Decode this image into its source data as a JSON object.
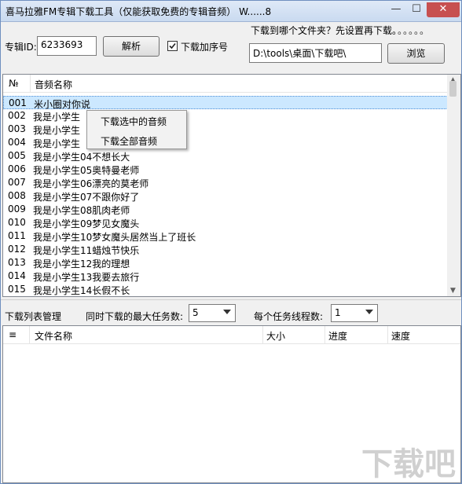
{
  "window": {
    "title": "喜马拉雅FM专辑下载工具（仅能获取免费的专辑音频）  W......8",
    "minimize": "—",
    "maximize": "☐",
    "close": "✕"
  },
  "toolbar": {
    "album_id_label": "专辑ID:",
    "album_id_value": "6233693",
    "parse_button": "解析",
    "download_seq_label": "下载加序号",
    "download_seq_checked": true,
    "folder_prompt": "下载到哪个文件夹？先设置再下载。",
    "loading_dots": "。。。。。",
    "folder_path": "D:\\tools\\桌面\\下载吧\\",
    "browse_button": "浏览"
  },
  "track_list": {
    "col_no": "№",
    "col_name": "音频名称",
    "rows": [
      {
        "no": "001",
        "name": "米小圈对你说"
      },
      {
        "no": "002",
        "name": "我是小学生01..."
      },
      {
        "no": "003",
        "name": "我是小学生02..."
      },
      {
        "no": "004",
        "name": "我是小学生03..."
      },
      {
        "no": "005",
        "name": "我是小学生04不想长大"
      },
      {
        "no": "006",
        "name": "我是小学生05奥特曼老师"
      },
      {
        "no": "007",
        "name": "我是小学生06漂亮的莫老师"
      },
      {
        "no": "008",
        "name": "我是小学生07不跟你好了"
      },
      {
        "no": "009",
        "name": "我是小学生08肌肉老师"
      },
      {
        "no": "010",
        "name": "我是小学生09梦见女魔头"
      },
      {
        "no": "011",
        "name": "我是小学生10梦女魔头居然当上了班长"
      },
      {
        "no": "012",
        "name": "我是小学生11蜡烛节快乐"
      },
      {
        "no": "013",
        "name": "我是小学生12我的理想"
      },
      {
        "no": "014",
        "name": "我是小学生13我要去旅行"
      },
      {
        "no": "015",
        "name": "我是小学生14长假不长"
      }
    ],
    "visible_rows": [
      {
        "no": "001",
        "name": "米小圈对你说"
      },
      {
        "no": "002",
        "name": "我是小学生"
      },
      {
        "no": "003",
        "name": "我是小学生"
      },
      {
        "no": "004",
        "name": "我是小学生"
      },
      {
        "no": "005",
        "name": "我是小学生04不想长大"
      },
      {
        "no": "006",
        "name": "我是小学生05奥特曼老师"
      },
      {
        "no": "007",
        "name": "我是小学生06漂亮的莫老师"
      },
      {
        "no": "008",
        "name": "我是小学生07不跟你好了"
      },
      {
        "no": "009",
        "name": "我是小学生08肌肉老师"
      },
      {
        "no": "010",
        "name": "我是小学生09梦见女魔头"
      },
      {
        "no": "011",
        "name": "我是小学生10梦女魔头居然当上了班长"
      },
      {
        "no": "012",
        "name": "我是小学生11蜡烛节快乐"
      },
      {
        "no": "013",
        "name": "我是小学生12我的理想"
      },
      {
        "no": "014",
        "name": "我是小学生13我要去旅行"
      },
      {
        "no": "015",
        "name": "我是小学生14长假不长"
      }
    ],
    "selected_index": 0
  },
  "context_menu": {
    "download_selected": "下载选中的音频",
    "download_all": "下载全部音频"
  },
  "download_manager": {
    "title": "下载列表管理",
    "max_tasks_label": "同时下载的最大任务数:",
    "max_tasks_value": "5",
    "threads_label": "每个任务线程数:",
    "threads_value": "1",
    "col_icon": "≡",
    "col_filename": "文件名称",
    "col_size": "大小",
    "col_progress": "进度",
    "col_speed": "速度"
  },
  "watermark": "下载吧"
}
